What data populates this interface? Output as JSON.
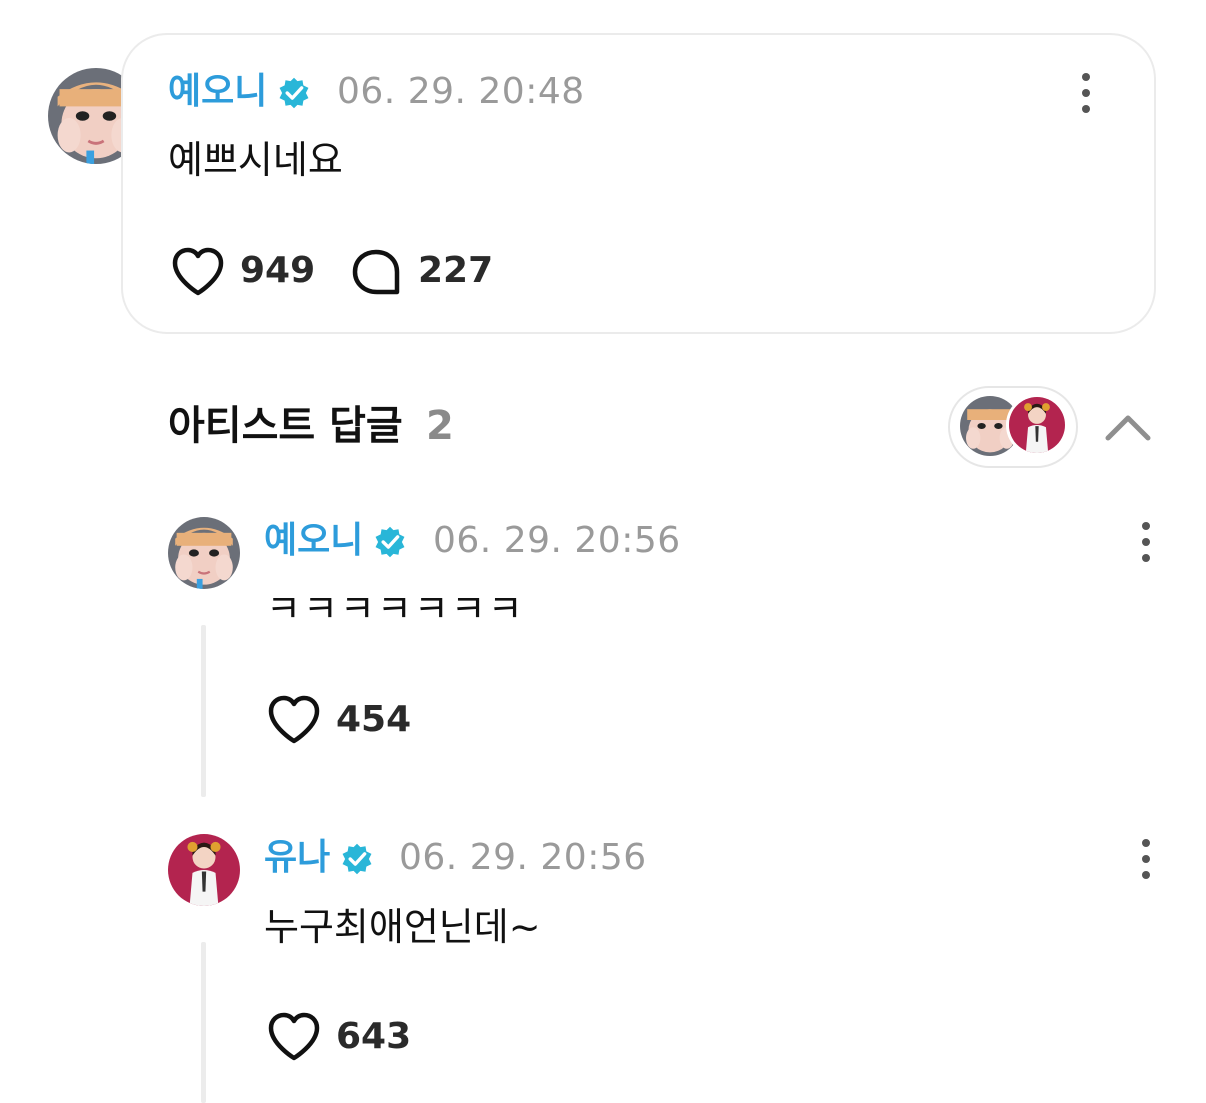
{
  "post": {
    "author": "예오니",
    "timestamp": "06. 29. 20:48",
    "text": "예쁘시네요",
    "likes": "949",
    "comments": "227"
  },
  "replies_header": {
    "title": "아티스트 답글",
    "count": "2"
  },
  "replies": [
    {
      "author": "예오니",
      "timestamp": "06. 29. 20:56",
      "text": "ㅋㅋㅋㅋㅋㅋㅋ",
      "likes": "454"
    },
    {
      "author": "유나",
      "timestamp": "06. 29. 20:56",
      "text": "누구최애언닌데~",
      "likes": "643"
    }
  ],
  "icons": {
    "like": "heart-icon",
    "comment": "speech-bubble-icon",
    "verified": "verified-badge-icon",
    "more": "more-vertical-icon",
    "collapse": "chevron-up-icon"
  },
  "colors": {
    "name": "#2d9cdb",
    "verified": "#29b6d8",
    "timestamp": "#9a9a9a"
  }
}
